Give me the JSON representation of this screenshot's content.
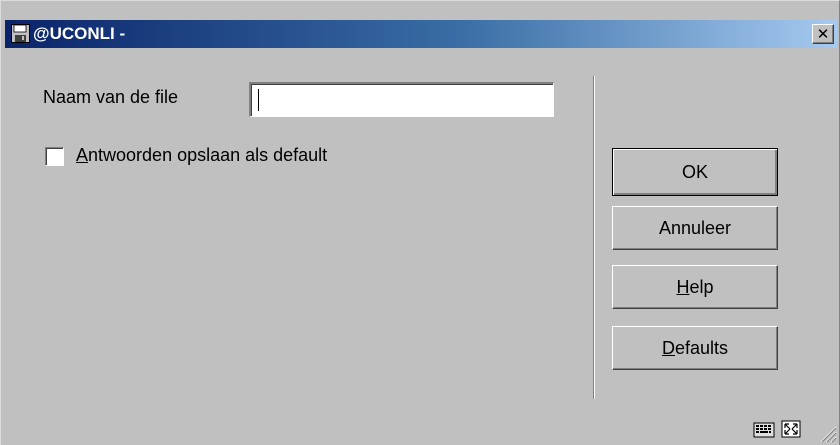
{
  "window": {
    "title": "@UCONLI -",
    "close_glyph": "✕",
    "app_icon": "floppy-disk-icon"
  },
  "form": {
    "filename_label": "Naam van de file",
    "filename_value": "",
    "save_defaults_checked": false,
    "save_defaults_label_mnemonic": "A",
    "save_defaults_label_rest": "ntwoorden opslaan als default"
  },
  "buttons": {
    "ok": "OK",
    "cancel": "Annuleer",
    "help_mnemonic": "H",
    "help_rest": "elp",
    "defaults_mnemonic": "D",
    "defaults_rest": "efaults"
  },
  "status_icons": [
    "keyboard-icon",
    "resize-arrows-icon",
    "size-grip-icon"
  ],
  "colors": {
    "titlebar_start": "#0a246a",
    "titlebar_end": "#a6caf0",
    "face": "#c0c0c0"
  }
}
